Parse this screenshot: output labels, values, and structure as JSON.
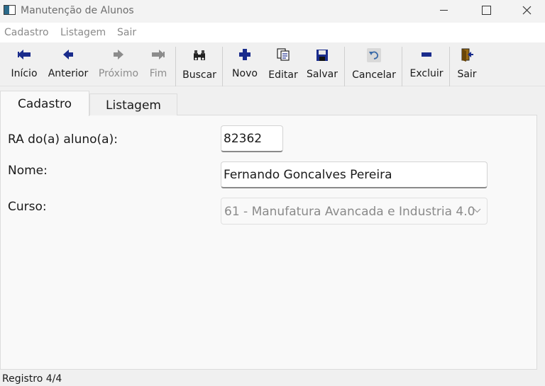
{
  "window": {
    "title": "Manutenção de Alunos"
  },
  "menu": [
    {
      "label": "Cadastro"
    },
    {
      "label": "Listagem"
    },
    {
      "label": "Sair"
    }
  ],
  "toolbar": {
    "inicio": "Início",
    "anterior": "Anterior",
    "proximo": "Próximo",
    "fim": "Fim",
    "buscar": "Buscar",
    "novo": "Novo",
    "editar": "Editar",
    "salvar": "Salvar",
    "cancelar": "Cancelar",
    "excluir": "Excluir",
    "sair": "Sair"
  },
  "tabs": [
    {
      "label": "Cadastro",
      "active": true
    },
    {
      "label": "Listagem",
      "active": false
    }
  ],
  "form": {
    "ra_label": "RA do(a) aluno(a):",
    "ra_value": "82362",
    "nome_label": "Nome:",
    "nome_value": "Fernando Goncalves Pereira",
    "curso_label": "Curso:",
    "curso_value": "61 - Manufatura Avancada e Industria 4.0"
  },
  "status": {
    "text": "Registro 4/4"
  },
  "colors": {
    "icon_blue": "#1a2c8c",
    "icon_disabled": "#8c8c8c",
    "icon_cancel": "#3a6aa8"
  }
}
